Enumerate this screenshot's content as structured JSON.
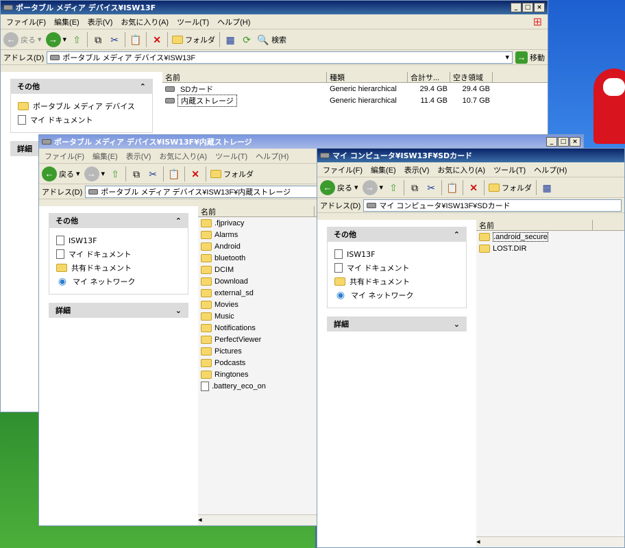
{
  "win1": {
    "title": "ポータブル メディア デバイス¥ISW13F",
    "menu": [
      "ファイル(F)",
      "編集(E)",
      "表示(V)",
      "お気に入り(A)",
      "ツール(T)",
      "ヘルプ(H)"
    ],
    "toolbar": {
      "back": "戻る",
      "folders": "フォルダ",
      "search": "検索"
    },
    "address_label": "アドレス(D)",
    "address": "ポータブル メディア デバイス¥ISW13F",
    "go": "移動",
    "tasks": {
      "other": "その他",
      "items": [
        "ポータブル メディア デバイス",
        "マイ ドキュメント"
      ],
      "details": "詳細"
    },
    "columns": [
      "名前",
      "種類",
      "合計サ...",
      "空き領域"
    ],
    "rows": [
      [
        "SDカード",
        "Generic hierarchical",
        "29.4 GB",
        "29.4 GB"
      ],
      [
        "内蔵ストレージ",
        "Generic hierarchical",
        "11.4 GB",
        "10.7 GB"
      ]
    ]
  },
  "win2": {
    "title": "ポータブル メディア デバイス¥ISW13F¥内蔵ストレージ",
    "menu": [
      "ファイル(F)",
      "編集(E)",
      "表示(V)",
      "お気に入り(A)",
      "ツール(T)",
      "ヘルプ(H)"
    ],
    "toolbar": {
      "back": "戻る",
      "folders": "フォルダ"
    },
    "address_label": "アドレス(D)",
    "address": "ポータブル メディア デバイス¥ISW13F¥内蔵ストレージ",
    "tasks": {
      "other": "その他",
      "items": [
        "ISW13F",
        "マイ ドキュメント",
        "共有ドキュメント",
        "マイ ネットワーク"
      ],
      "details": "詳細"
    },
    "column": "名前",
    "files": [
      ".fjprivacy",
      "Alarms",
      "Android",
      "bluetooth",
      "DCIM",
      "Download",
      "external_sd",
      "Movies",
      "Music",
      "Notifications",
      "PerfectViewer",
      "Pictures",
      "Podcasts",
      "Ringtones",
      ".battery_eco_on"
    ]
  },
  "win3": {
    "title": "マイ コンピュータ¥ISW13F¥SDカード",
    "menu": [
      "ファイル(F)",
      "編集(E)",
      "表示(V)",
      "お気に入り(A)",
      "ツール(T)",
      "ヘルプ(H)"
    ],
    "toolbar": {
      "back": "戻る",
      "folders": "フォルダ"
    },
    "address_label": "アドレス(D)",
    "address": "マイ コンピュータ¥ISW13F¥SDカード",
    "tasks": {
      "other": "その他",
      "items": [
        "ISW13F",
        "マイ ドキュメント",
        "共有ドキュメント",
        "マイ ネットワーク"
      ],
      "details": "詳細"
    },
    "column": "名前",
    "files": [
      ".android_secure",
      "LOST.DIR"
    ]
  }
}
